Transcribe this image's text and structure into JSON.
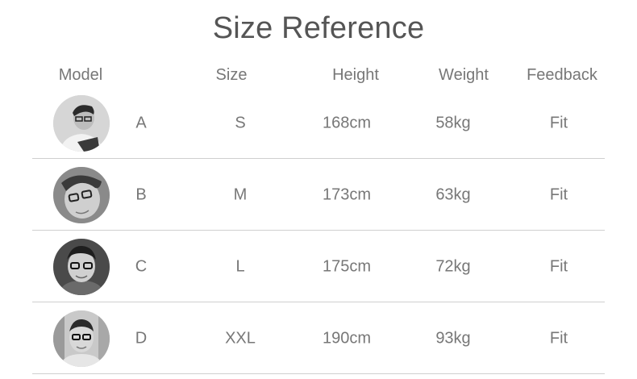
{
  "title": "Size Reference",
  "headers": {
    "model": "Model",
    "size": "Size",
    "height": "Height",
    "weight": "Weight",
    "feedback": "Feedback"
  },
  "rows": [
    {
      "model": "A",
      "size": "S",
      "height": "168cm",
      "weight": "58kg",
      "feedback": "Fit"
    },
    {
      "model": "B",
      "size": "M",
      "height": "173cm",
      "weight": "63kg",
      "feedback": "Fit"
    },
    {
      "model": "C",
      "size": "L",
      "height": "175cm",
      "weight": "72kg",
      "feedback": "Fit"
    },
    {
      "model": "D",
      "size": "XXL",
      "height": "190cm",
      "weight": "93kg",
      "feedback": "Fit"
    }
  ]
}
